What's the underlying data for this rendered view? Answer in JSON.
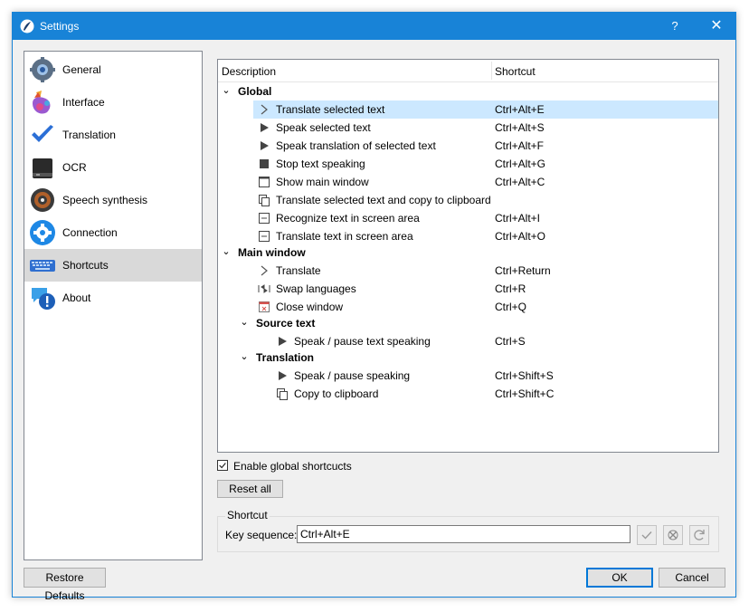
{
  "window": {
    "title": "Settings",
    "help": "?",
    "close": "✕"
  },
  "sidebar": {
    "items": [
      {
        "label": "General",
        "icon": "gear-icon"
      },
      {
        "label": "Interface",
        "icon": "palette-icon"
      },
      {
        "label": "Translation",
        "icon": "checkmark-icon"
      },
      {
        "label": "OCR",
        "icon": "scanner-icon"
      },
      {
        "label": "Speech synthesis",
        "icon": "speaker-icon"
      },
      {
        "label": "Connection",
        "icon": "settings-cog-icon"
      },
      {
        "label": "Shortcuts",
        "icon": "keyboard-icon"
      },
      {
        "label": "About",
        "icon": "info-chat-icon"
      }
    ],
    "selected": "Shortcuts"
  },
  "tree": {
    "headers": {
      "description": "Description",
      "shortcut": "Shortcut"
    },
    "rows": [
      {
        "desc": "Global",
        "shortcut": ""
      },
      {
        "desc": "Translate selected text",
        "shortcut": "Ctrl+Alt+E"
      },
      {
        "desc": "Speak selected text",
        "shortcut": "Ctrl+Alt+S"
      },
      {
        "desc": "Speak translation of selected text",
        "shortcut": "Ctrl+Alt+F"
      },
      {
        "desc": "Stop text speaking",
        "shortcut": "Ctrl+Alt+G"
      },
      {
        "desc": "Show main window",
        "shortcut": "Ctrl+Alt+C"
      },
      {
        "desc": "Translate selected text and copy to clipboard",
        "shortcut": ""
      },
      {
        "desc": "Recognize text in screen area",
        "shortcut": "Ctrl+Alt+I"
      },
      {
        "desc": "Translate text in screen area",
        "shortcut": "Ctrl+Alt+O"
      },
      {
        "desc": "Main window",
        "shortcut": ""
      },
      {
        "desc": "Translate",
        "shortcut": "Ctrl+Return"
      },
      {
        "desc": "Swap languages",
        "shortcut": "Ctrl+R"
      },
      {
        "desc": "Close window",
        "shortcut": "Ctrl+Q"
      },
      {
        "desc": "Source text",
        "shortcut": ""
      },
      {
        "desc": "Speak / pause text speaking",
        "shortcut": "Ctrl+S"
      },
      {
        "desc": "Translation",
        "shortcut": ""
      },
      {
        "desc": "Speak / pause speaking",
        "shortcut": "Ctrl+Shift+S"
      },
      {
        "desc": "Copy to clipboard",
        "shortcut": "Ctrl+Shift+C"
      }
    ]
  },
  "controls": {
    "enable_global": "Enable global shortcucts",
    "enable_global_checked": true,
    "reset_all": "Reset all",
    "shortcut_group": "Shortcut",
    "key_sequence_label": "Key sequence:",
    "key_sequence_value": "Ctrl+Alt+E"
  },
  "footer": {
    "restore": "Restore Defaults",
    "ok": "OK",
    "cancel": "Cancel"
  },
  "colors": {
    "accent": "#1883d7",
    "selection": "#cce8ff"
  }
}
